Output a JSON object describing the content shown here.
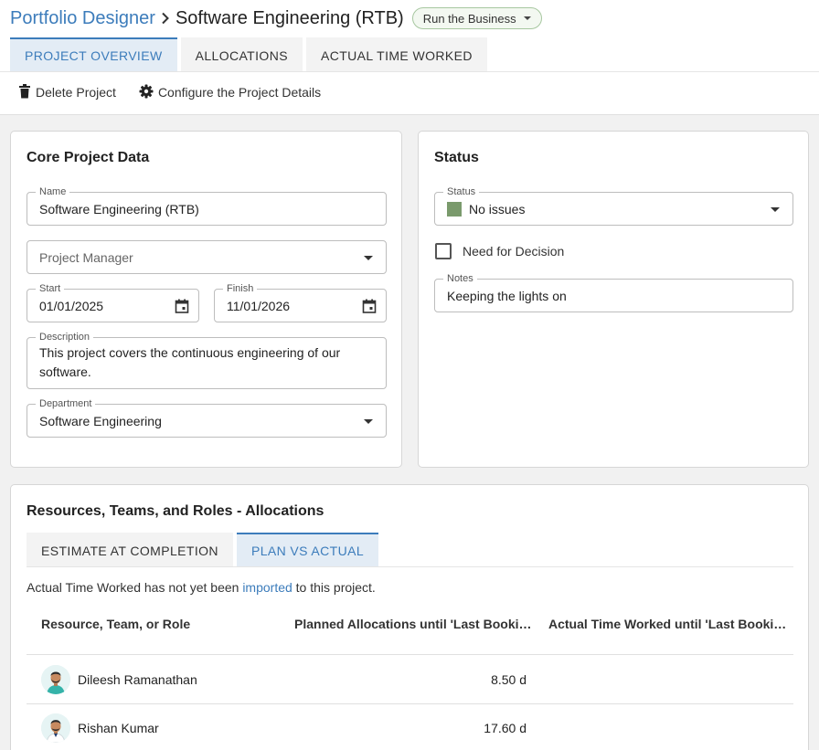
{
  "breadcrumb": {
    "app": "Portfolio Designer",
    "project": "Software Engineering (RTB)"
  },
  "category_chip": "Run the Business",
  "tabs": [
    {
      "label": "PROJECT OVERVIEW",
      "active": true
    },
    {
      "label": "ALLOCATIONS",
      "active": false
    },
    {
      "label": "ACTUAL TIME WORKED",
      "active": false
    }
  ],
  "toolbar": {
    "delete_label": "Delete Project",
    "configure_label": "Configure the Project Details"
  },
  "core": {
    "title": "Core Project Data",
    "name_label": "Name",
    "name_value": "Software Engineering (RTB)",
    "manager_placeholder": "Project Manager",
    "start_label": "Start",
    "start_value": "01/01/2025",
    "finish_label": "Finish",
    "finish_value": "11/01/2026",
    "description_label": "Description",
    "description_value": "This project covers the continuous engineering of our software.",
    "department_label": "Department",
    "department_value": "Software Engineering"
  },
  "status": {
    "title": "Status",
    "status_label": "Status",
    "status_value": "No issues",
    "status_color": "#7a9a6c",
    "decision_label": "Need for Decision",
    "decision_checked": false,
    "notes_label": "Notes",
    "notes_value": "Keeping the lights on"
  },
  "allocations": {
    "title": "Resources, Teams, and Roles - Allocations",
    "subtabs": [
      {
        "label": "ESTIMATE AT COMPLETION",
        "active": false
      },
      {
        "label": "PLAN VS ACTUAL",
        "active": true
      }
    ],
    "notice_before": "Actual Time Worked has not yet been ",
    "notice_link": "imported",
    "notice_after": " to this project.",
    "columns": [
      "Resource, Team, or Role",
      "Planned Allocations until 'Last Bookin…",
      "Actual Time Worked until 'Last Bookin…"
    ],
    "rows": [
      {
        "name": "Dileesh Ramanathan",
        "planned": "8.50 d",
        "actual": ""
      },
      {
        "name": "Rishan Kumar",
        "planned": "17.60 d",
        "actual": ""
      }
    ]
  },
  "colors": {
    "accent": "#3c7cbb",
    "tab_active_bg": "#e3ecf5",
    "chip_border": "#a7c7a0"
  }
}
